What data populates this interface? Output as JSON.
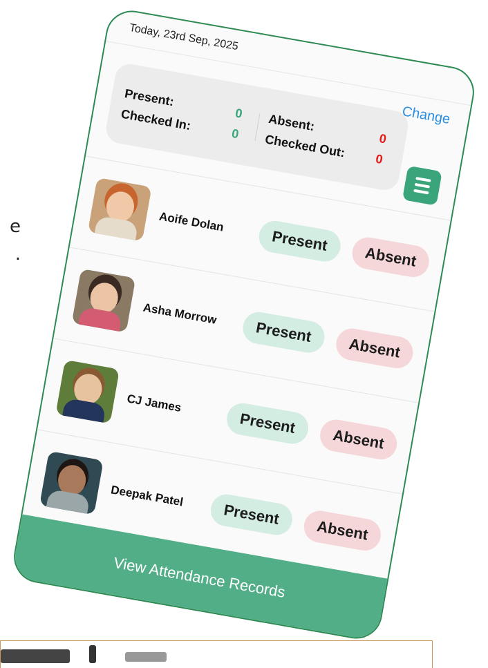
{
  "side_text": [
    "e",
    "."
  ],
  "header": {
    "date": "Today,  23rd Sep, 2025",
    "change_label": "Change"
  },
  "summary": {
    "present_label": "Present:",
    "present_value": "0",
    "checked_in_label": "Checked In:",
    "checked_in_value": "0",
    "absent_label": "Absent:",
    "absent_value": "0",
    "checked_out_label": "Checked Out:",
    "checked_out_value": "0"
  },
  "menu_icon": "hamburger-menu-icon",
  "students": [
    {
      "name": "Aoife Dolan",
      "present_label": "Present",
      "absent_label": "Absent"
    },
    {
      "name": "Asha Morrow",
      "present_label": "Present",
      "absent_label": "Absent"
    },
    {
      "name": "CJ James",
      "present_label": "Present",
      "absent_label": "Absent"
    },
    {
      "name": "Deepak Patel",
      "present_label": "Present",
      "absent_label": "Absent"
    }
  ],
  "footer": {
    "label": "View Attendance Records"
  },
  "colors": {
    "accent_green": "#52ae87",
    "present_bg": "#d4ede3",
    "absent_bg": "#f6d7d9",
    "link_blue": "#2a8ee0",
    "absent_red": "#e31b1b"
  }
}
